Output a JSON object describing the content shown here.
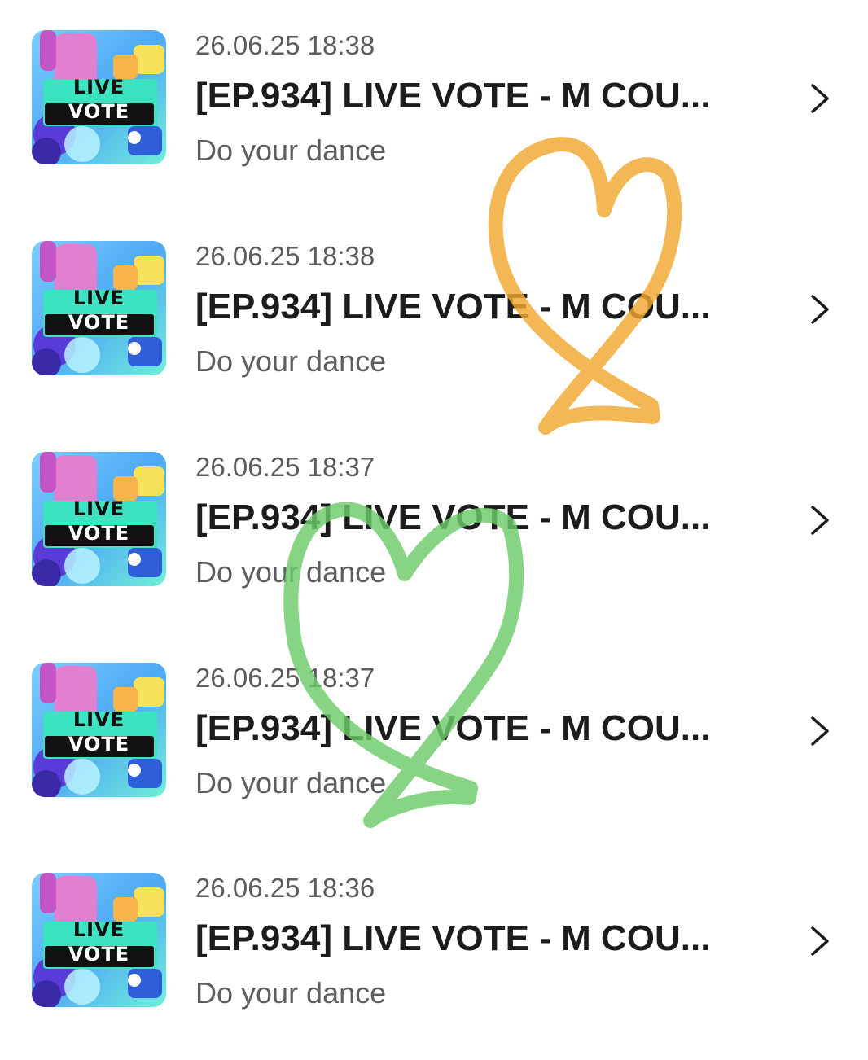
{
  "notifications": [
    {
      "date": "26.06.25 18:38",
      "title": "[EP.934] LIVE VOTE - M COU...",
      "subtitle": "Do your dance",
      "thumb_line1": "LIVE",
      "thumb_line2": "VOTE"
    },
    {
      "date": "26.06.25 18:38",
      "title": "[EP.934] LIVE VOTE - M COU...",
      "subtitle": "Do your dance",
      "thumb_line1": "LIVE",
      "thumb_line2": "VOTE"
    },
    {
      "date": "26.06.25 18:37",
      "title": "[EP.934] LIVE VOTE - M COU...",
      "subtitle": "Do your dance",
      "thumb_line1": "LIVE",
      "thumb_line2": "VOTE"
    },
    {
      "date": "26.06.25 18:37",
      "title": "[EP.934] LIVE VOTE - M COU...",
      "subtitle": "Do your dance",
      "thumb_line1": "LIVE",
      "thumb_line2": "VOTE"
    },
    {
      "date": "26.06.25 18:36",
      "title": "[EP.934] LIVE VOTE - M COU...",
      "subtitle": "Do your dance",
      "thumb_line1": "LIVE",
      "thumb_line2": "VOTE"
    }
  ],
  "icons": {
    "row_arrow": "chevron-right-icon",
    "doodle_1": "orange-heart-doodle",
    "doodle_2": "green-heart-doodle"
  },
  "colors": {
    "orange_heart": "#f0a830",
    "green_heart": "#6cca6a",
    "thumb_banner": "#3de3c0",
    "thumb_bg": "#59b8f0",
    "text_primary": "#1c1c1c",
    "text_secondary": "#5c5c5c"
  }
}
